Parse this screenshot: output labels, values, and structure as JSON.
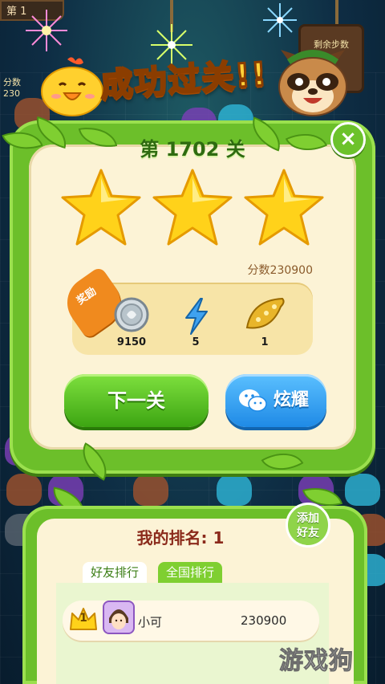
{
  "background": {
    "top_left_label": "第 1",
    "side_label_1": "分数",
    "side_label_2": "230",
    "moves_sign_label": "剩余步数"
  },
  "header": {
    "title": "成功过关!!"
  },
  "level": {
    "title": "第 1702 关",
    "close_label": "×",
    "stars_earned": 3,
    "score_text": "分数230900"
  },
  "rewards": {
    "ribbon_label": "奖励",
    "items": [
      {
        "icon": "silver-coin-icon",
        "count": "9150"
      },
      {
        "icon": "lightning-bolt-icon",
        "count": "5"
      },
      {
        "icon": "golden-bean-icon",
        "count": "1"
      }
    ]
  },
  "buttons": {
    "next_label": "下一关",
    "share_label": "炫耀"
  },
  "ranking": {
    "title": "我的排名: 1",
    "add_friend_label_1": "添加",
    "add_friend_label_2": "好友",
    "tabs": [
      {
        "label": "好友排行",
        "active": true
      },
      {
        "label": "全国排行",
        "active": false
      }
    ],
    "rows": [
      {
        "rank": "1",
        "name": "小可",
        "score": "230900"
      }
    ]
  },
  "watermark": "游戏狗",
  "colors": {
    "vine_green": "#6cbf2a",
    "cream": "#fcf3d6",
    "title_gold": "#ffd23a",
    "next_button": "#3da512",
    "share_button": "#1f8ae6",
    "rank_title": "#8b2a1b"
  }
}
